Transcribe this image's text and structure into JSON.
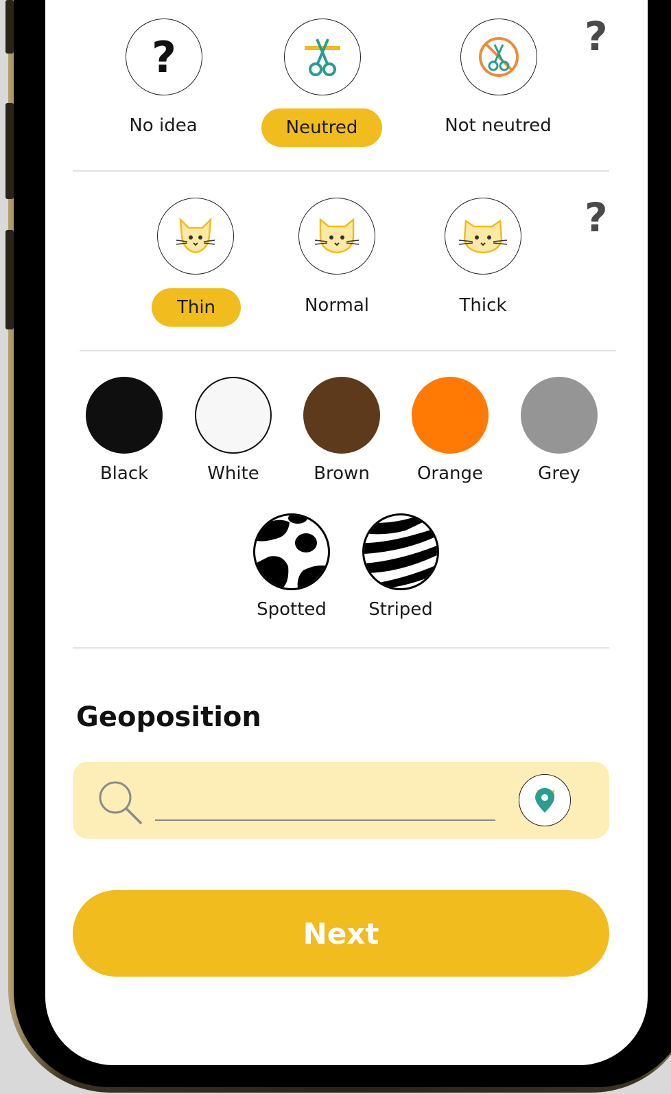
{
  "neuter": {
    "help": "?",
    "options": [
      {
        "label": "No idea",
        "icon": "question-icon"
      },
      {
        "label": "Neutred",
        "icon": "scissors-icon",
        "selected": true
      },
      {
        "label": "Not neutred",
        "icon": "no-scissors-icon"
      }
    ]
  },
  "body": {
    "help": "?",
    "options": [
      {
        "label": "Thin",
        "icon": "thin-cat-icon",
        "selected": true
      },
      {
        "label": "Normal",
        "icon": "normal-cat-icon"
      },
      {
        "label": "Thick",
        "icon": "thick-cat-icon"
      }
    ]
  },
  "colors": {
    "options": [
      {
        "label": "Black",
        "hex": "#0f0f0f"
      },
      {
        "label": "White",
        "hex": "#f7f7f7"
      },
      {
        "label": "Brown",
        "hex": "#5c3a1b"
      },
      {
        "label": "Orange",
        "hex": "#ff7a05"
      },
      {
        "label": "Grey",
        "hex": "#959595"
      }
    ],
    "patterns": [
      {
        "label": "Spotted",
        "icon": "spotted-pattern-icon"
      },
      {
        "label": "Striped",
        "icon": "striped-pattern-icon"
      }
    ]
  },
  "geoposition": {
    "title": "Geoposition",
    "search_value": "",
    "location_icon": "location-pin-icon"
  },
  "next_label": "Next",
  "accent": "#f0bc1e",
  "teal": "#2a9d8f"
}
